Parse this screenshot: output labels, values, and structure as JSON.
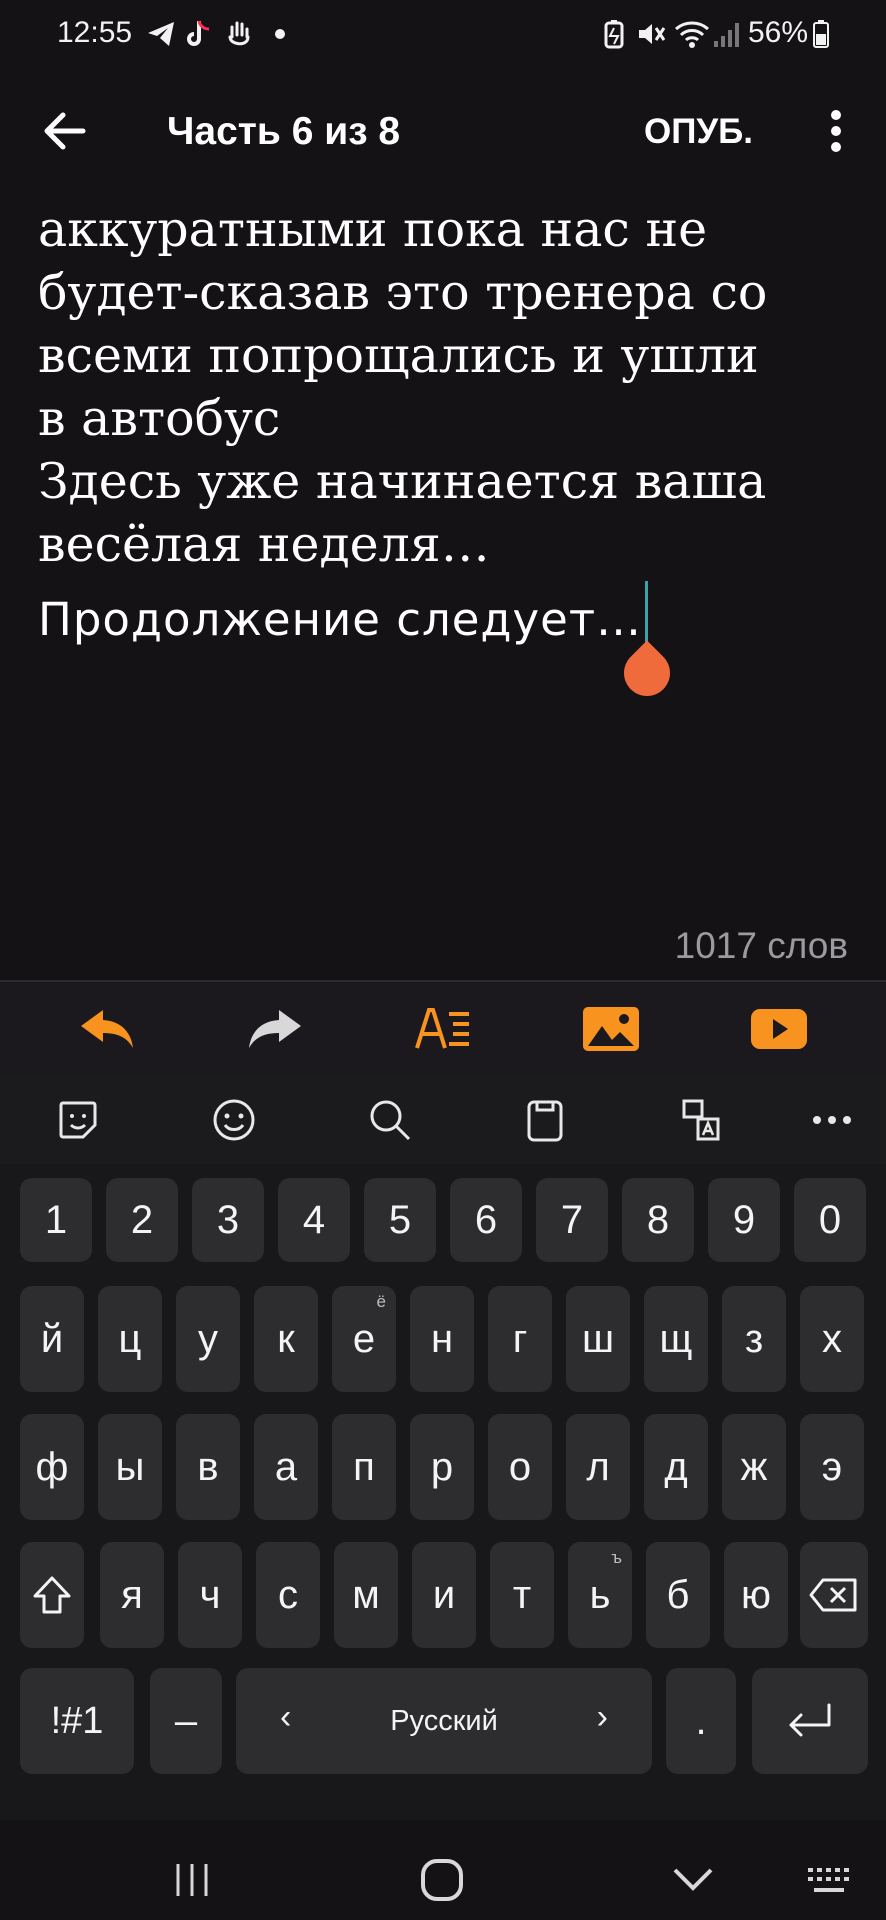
{
  "status_bar": {
    "time": "12:55",
    "battery": "56%",
    "icons": [
      "telegram-icon",
      "tiktok-icon",
      "hand-icon",
      "dot-icon",
      "battery-saver-icon",
      "mute-icon",
      "wifi-icon",
      "signal-icon",
      "battery-icon"
    ]
  },
  "header": {
    "back_icon": "arrow-left-icon",
    "title": "Часть 6 из 8",
    "publish_label": "ОПУБ.",
    "menu_icon": "more-vertical-icon"
  },
  "editor": {
    "body_text": "аккуратными пока нас не\nбудет-сказав это тренера со\nвсеми попрощались и ушли\nв автобус\nЗдесь уже начинается ваша\nвесёлая неделя…",
    "continuation_text": "Продолжение следует…",
    "word_count": "1017 слов"
  },
  "format_toolbar": {
    "items": [
      "undo-icon",
      "redo-icon",
      "text-format-icon",
      "image-icon",
      "video-icon"
    ],
    "accent_color": "#f7931e",
    "disabled_color": "#d8d8d8"
  },
  "keyboard_toolbar": {
    "items": [
      "sticker-icon",
      "emoji-icon",
      "search-icon",
      "clipboard-icon",
      "translate-icon",
      "more-horizontal-icon"
    ]
  },
  "keyboard": {
    "numbers": [
      "1",
      "2",
      "3",
      "4",
      "5",
      "6",
      "7",
      "8",
      "9",
      "0"
    ],
    "row1": [
      "й",
      "ц",
      "у",
      "к",
      "е",
      "н",
      "г",
      "ш",
      "щ",
      "з",
      "х"
    ],
    "row1_hint_e": "ё",
    "row2": [
      "ф",
      "ы",
      "в",
      "а",
      "п",
      "р",
      "о",
      "л",
      "д",
      "ж",
      "э"
    ],
    "row3": [
      "я",
      "ч",
      "с",
      "м",
      "и",
      "т",
      "ь",
      "б",
      "ю"
    ],
    "row3_hint_soft": "ъ",
    "symbols_label": "!#1",
    "dash_label": "–",
    "space_label": "Русский",
    "space_left": "‹",
    "space_right": "›",
    "period_label": "."
  },
  "nav_bar": {
    "items": [
      "recents-icon",
      "home-icon",
      "back-chevron-icon",
      "keyboard-switch-icon"
    ]
  }
}
